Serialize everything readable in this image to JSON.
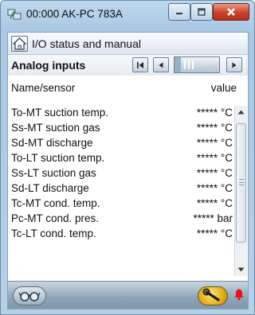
{
  "window": {
    "title": "00:000 AK-PC 783A"
  },
  "screen": {
    "title": "I/O status and manual"
  },
  "section": {
    "title": "Analog inputs"
  },
  "columns": {
    "name": "Name/sensor",
    "value": "value"
  },
  "rows": [
    {
      "name": "To-MT suction temp.",
      "value": "***** °C"
    },
    {
      "name": "Ss-MT suction gas",
      "value": "***** °C"
    },
    {
      "name": "Sd-MT discharge",
      "value": "***** °C"
    },
    {
      "name": "To-LT suction temp.",
      "value": "***** °C"
    },
    {
      "name": "Ss-LT suction gas",
      "value": "***** °C"
    },
    {
      "name": "Sd-LT discharge",
      "value": "***** °C"
    },
    {
      "name": "Tc-MT cond. temp.",
      "value": "***** °C"
    },
    {
      "name": "Pc-MT cond. pres.",
      "value": "***** bar"
    },
    {
      "name": "Tc-LT cond. temp.",
      "value": "***** °C"
    }
  ],
  "icons": {
    "app": "network-icon",
    "home": "home-icon",
    "first": "first-page-icon",
    "prev": "previous-page-icon",
    "next": "next-page-icon",
    "glasses": "glasses-icon",
    "tool": "wrench-icon",
    "alarm": "alarm-bell-icon"
  },
  "colors": {
    "close_button": "#c9432a",
    "alarm": "#e8101a",
    "tool_button": "#e7ad1b"
  }
}
